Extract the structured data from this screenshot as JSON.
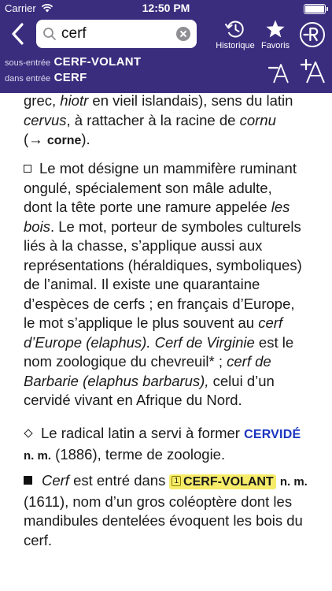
{
  "status": {
    "carrier": "Carrier",
    "time": "12:50 PM"
  },
  "search": {
    "value": "cerf"
  },
  "toolbar": {
    "history_label": "Historique",
    "favorites_label": "Favoris"
  },
  "entry": {
    "subentry_prefix": "sous-entrée",
    "subentry_value": "CERF-VOLANT",
    "in_prefix": "dans entrée",
    "in_value": "CERF"
  },
  "content": {
    "p0": {
      "l1": "grec, ",
      "l1i": "hiotr",
      "l1b": " en vieil islandais), sens du latin",
      "l2i": "cervus",
      "l2b": ", à rattacher à la racine de ",
      "l2i2": "cornu",
      "l3a": "(→ ",
      "l3ref": "corne",
      "l3b": ")."
    },
    "p1": {
      "l1": "Le mot désigne un mammifère ruminant",
      "l2": "ongulé, spécialement son mâle adulte,",
      "l3a": "dont la tête porte une ramure appelée ",
      "l3i": "les",
      "l4i": "bois",
      "l4b": ". Le mot, porteur de symboles culturels",
      "l5": "liés à la chasse, s’applique aussi aux",
      "l6": "représentations (héraldiques, symboliques)",
      "l7": "de l’animal. Il existe une quarantaine",
      "l8": "d’espèces de cerfs ; en français d’Europe,",
      "l9a": "le mot s’applique le plus souvent au ",
      "l9i": "cerf",
      "l10i": "d’Europe (elaphus). Cerf de Virginie",
      "l10b": " est le",
      "l11a": "nom zoologique du chevreuil* ; ",
      "l11i": "cerf de",
      "l12i": "Barbarie (elaphus barbarus),",
      "l12b": " celui d’un",
      "l13": "cervidé vivant en Afrique du Nord."
    },
    "p2": {
      "l1a": "Le radical latin a servi à former ",
      "l1ref": "CERVIDÉ",
      "l2gram": "n. m.",
      "l2b": " (1886), terme de zoologie."
    },
    "p3": {
      "l1i": "Cerf",
      "l1a": " est entré dans ",
      "l1num": "1",
      "l1hl": "CERF-VOLANT",
      "l1gram": "n. m.",
      "l2": "(1611), nom d’un gros coléoptère dont les",
      "l3": "mandibules dentelées évoquent les bois du",
      "l4": "cerf."
    }
  },
  "colors": {
    "header": "#3a2d7e",
    "link": "#1a34c0",
    "highlight": "#f6ec6a"
  },
  "icons": [
    "wifi-icon",
    "battery-icon",
    "back-chevron-icon",
    "search-icon",
    "clear-icon",
    "history-icon",
    "star-icon",
    "le-robert-logo-icon",
    "font-smaller-icon",
    "font-larger-icon"
  ]
}
